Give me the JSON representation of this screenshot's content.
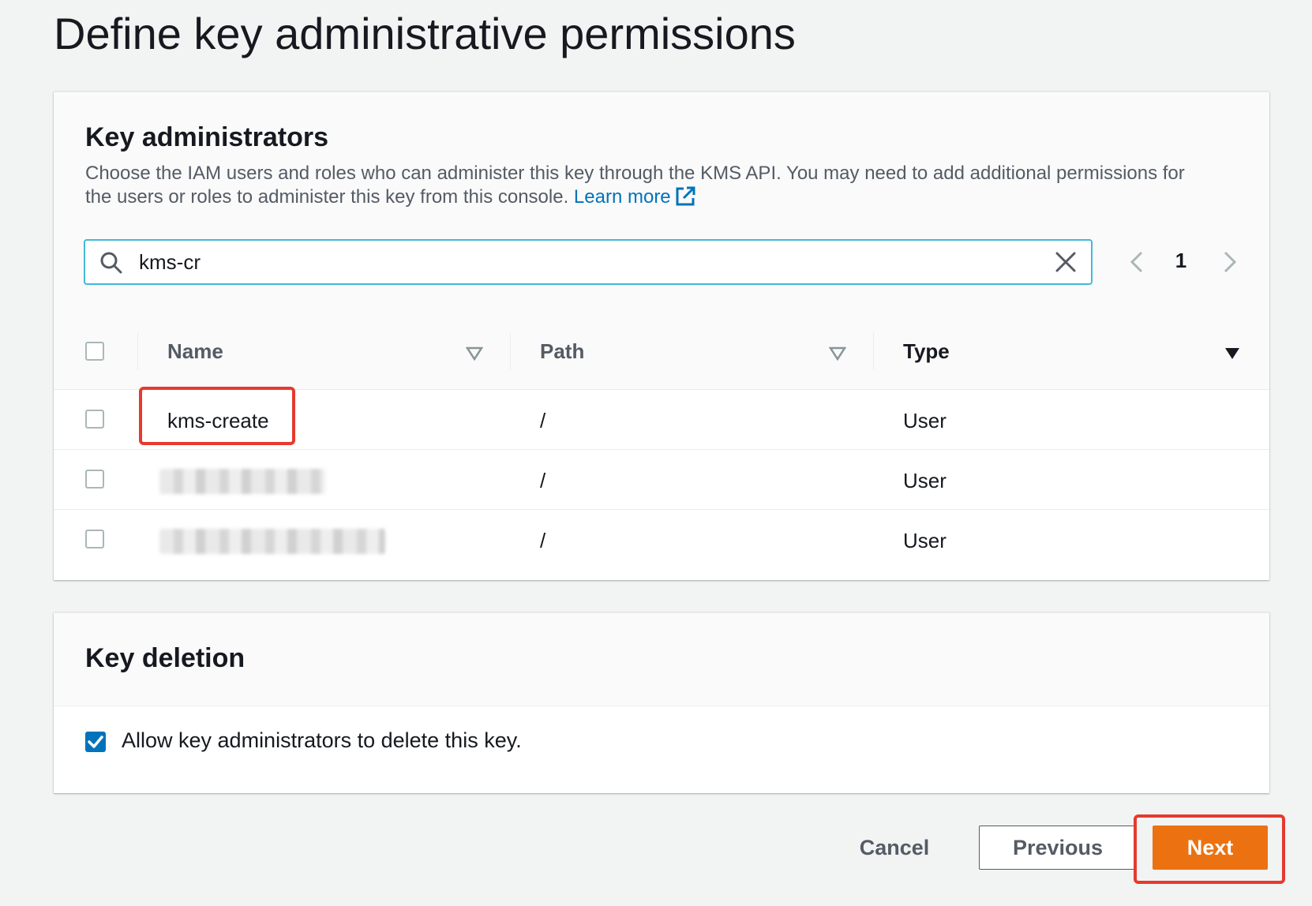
{
  "page": {
    "title": "Define key administrative permissions"
  },
  "admins": {
    "title": "Key administrators",
    "description": "Choose the IAM users and roles who can administer this key through the KMS API. You may need to add additional permissions for the users or roles to administer this key from this console.",
    "learn_more": "Learn more",
    "search": {
      "value": "kms-cr",
      "icon": "search-icon"
    },
    "pager": {
      "current_page": "1"
    },
    "table": {
      "headers": {
        "name": "Name",
        "path": "Path",
        "type": "Type"
      },
      "rows": [
        {
          "name": "kms-create",
          "path": "/",
          "type": "User",
          "highlighted": true
        },
        {
          "name": "",
          "path": "/",
          "type": "User",
          "redacted": true
        },
        {
          "name": "",
          "path": "/",
          "type": "User",
          "redacted": true
        }
      ]
    }
  },
  "deletion": {
    "title": "Key deletion",
    "checkbox_label": "Allow key administrators to delete this key.",
    "checked": true
  },
  "footer": {
    "cancel": "Cancel",
    "previous": "Previous",
    "next": "Next"
  },
  "colors": {
    "accent": "#0073bb",
    "primary_button": "#ec7211",
    "highlight": "#e53a2f",
    "focus_border": "#44b9d6"
  }
}
